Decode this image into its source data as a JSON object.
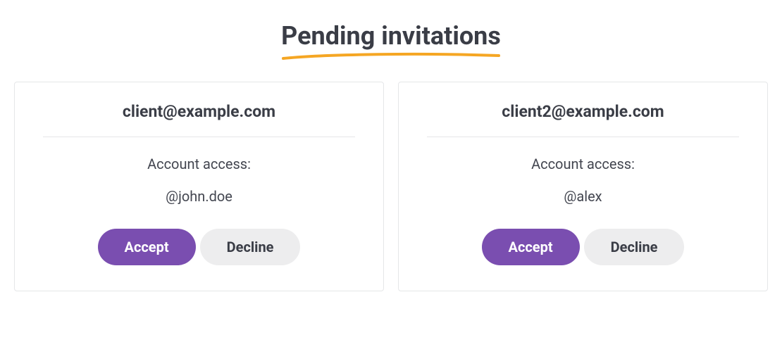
{
  "header": {
    "title": "Pending invitations"
  },
  "invitations": [
    {
      "email": "client@example.com",
      "access_label": "Account access:",
      "account_handle": "@john.doe",
      "accept_label": "Accept",
      "decline_label": "Decline"
    },
    {
      "email": "client2@example.com",
      "access_label": "Account access:",
      "account_handle": "@alex",
      "accept_label": "Accept",
      "decline_label": "Decline"
    }
  ],
  "colors": {
    "accent": "#7a4eb0",
    "underline": "#f5a623",
    "text_dark": "#3a3d46",
    "border": "#e5e6e8",
    "btn_secondary_bg": "#ededee"
  }
}
